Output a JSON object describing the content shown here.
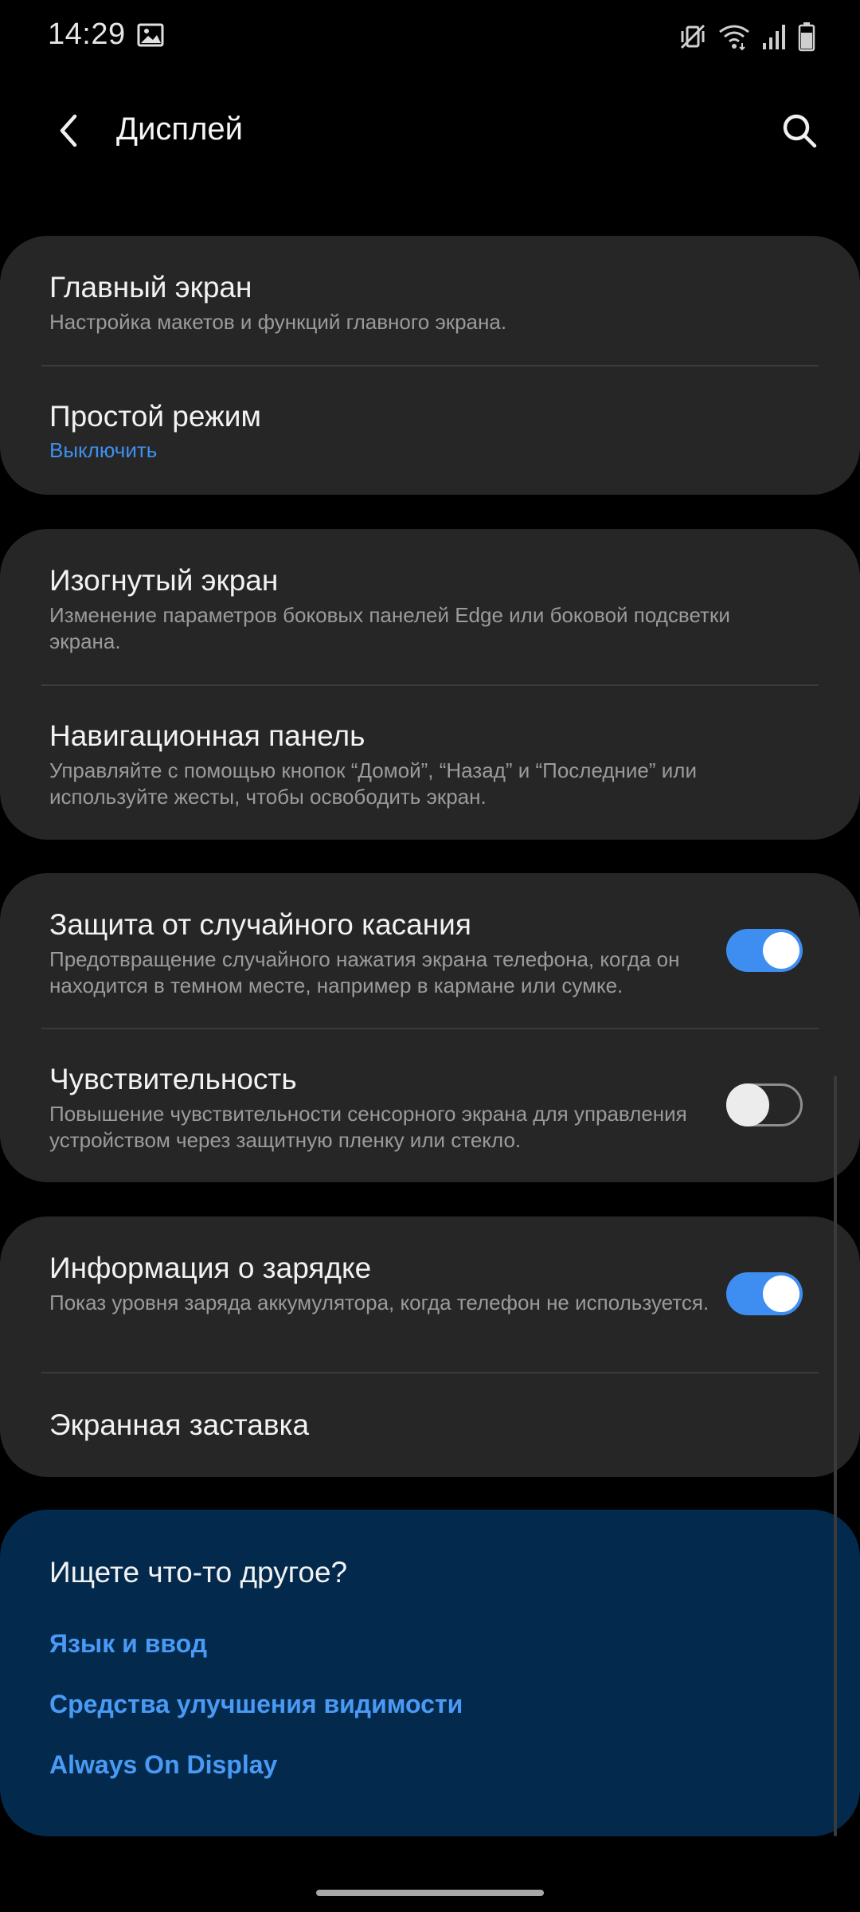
{
  "status_bar": {
    "time": "14:29",
    "icons": [
      "gallery-icon",
      "mute-vibrate-icon",
      "wifi-icon",
      "signal-icon",
      "battery-icon"
    ]
  },
  "header": {
    "title": "Дисплей",
    "back_icon": "back-arrow-icon",
    "search_icon": "search-icon"
  },
  "cards": {
    "home": {
      "main_screen": {
        "title": "Главный экран",
        "subtitle": "Настройка макетов и функций главного экрана."
      },
      "easy_mode": {
        "title": "Простой режим",
        "status": "Выключить"
      }
    },
    "edge": {
      "curved_screen": {
        "title": "Изогнутый экран",
        "subtitle": "Изменение параметров боковых панелей Edge или боковой подсветки экрана."
      },
      "nav_bar": {
        "title": "Навигационная панель",
        "subtitle": "Управляйте с помощью кнопок “Домой”, “Назад” и “Последние” или используйте жесты, чтобы освободить экран."
      }
    },
    "touch": {
      "accidental_touch": {
        "title": "Защита от случайного касания",
        "subtitle": "Предотвращение случайного нажатия экрана телефона, когда он находится в темном месте, например в кармане или сумке.",
        "enabled": true
      },
      "sensitivity": {
        "title": "Чувствительность",
        "subtitle": "Повышение чувствительности сенсорного экрана для управления устройством через защитную пленку или стекло.",
        "enabled": false
      }
    },
    "charging": {
      "charging_info": {
        "title": "Информация о зарядке",
        "subtitle": "Показ уровня заряда аккумулятора, когда телефон не используется.",
        "enabled": true
      },
      "screensaver": {
        "title": "Экранная заставка"
      }
    }
  },
  "suggestions": {
    "title": "Ищете что-то другое?",
    "links": [
      "Язык и ввод",
      "Средства улучшения видимости",
      "Always On Display"
    ]
  },
  "colors": {
    "background": "#000000",
    "card": "#262626",
    "accent": "#3e8ef2",
    "link": "#4a9af5",
    "suggest_bg": "#032a4d"
  }
}
